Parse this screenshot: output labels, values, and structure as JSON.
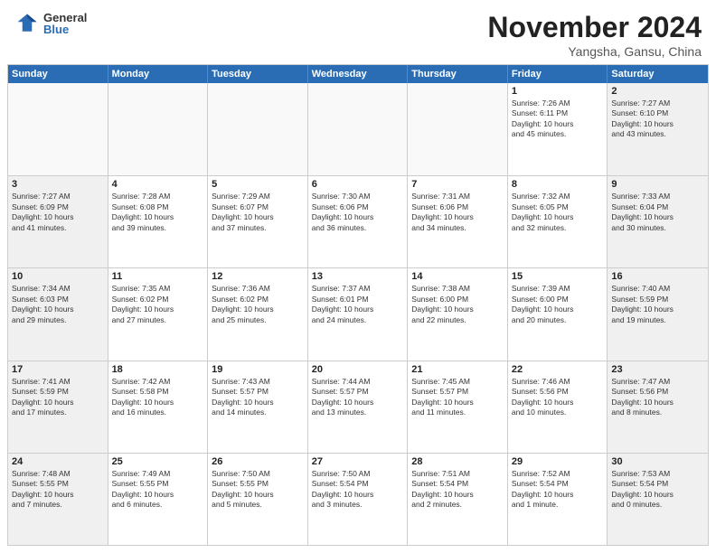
{
  "header": {
    "logo_general": "General",
    "logo_blue": "Blue",
    "title": "November 2024",
    "location": "Yangsha, Gansu, China"
  },
  "weekdays": [
    "Sunday",
    "Monday",
    "Tuesday",
    "Wednesday",
    "Thursday",
    "Friday",
    "Saturday"
  ],
  "weeks": [
    [
      {
        "day": "",
        "info": "",
        "empty": true
      },
      {
        "day": "",
        "info": "",
        "empty": true
      },
      {
        "day": "",
        "info": "",
        "empty": true
      },
      {
        "day": "",
        "info": "",
        "empty": true
      },
      {
        "day": "",
        "info": "",
        "empty": true
      },
      {
        "day": "1",
        "info": "Sunrise: 7:26 AM\nSunset: 6:11 PM\nDaylight: 10 hours\nand 45 minutes.",
        "empty": false
      },
      {
        "day": "2",
        "info": "Sunrise: 7:27 AM\nSunset: 6:10 PM\nDaylight: 10 hours\nand 43 minutes.",
        "empty": false
      }
    ],
    [
      {
        "day": "3",
        "info": "Sunrise: 7:27 AM\nSunset: 6:09 PM\nDaylight: 10 hours\nand 41 minutes.",
        "empty": false
      },
      {
        "day": "4",
        "info": "Sunrise: 7:28 AM\nSunset: 6:08 PM\nDaylight: 10 hours\nand 39 minutes.",
        "empty": false
      },
      {
        "day": "5",
        "info": "Sunrise: 7:29 AM\nSunset: 6:07 PM\nDaylight: 10 hours\nand 37 minutes.",
        "empty": false
      },
      {
        "day": "6",
        "info": "Sunrise: 7:30 AM\nSunset: 6:06 PM\nDaylight: 10 hours\nand 36 minutes.",
        "empty": false
      },
      {
        "day": "7",
        "info": "Sunrise: 7:31 AM\nSunset: 6:06 PM\nDaylight: 10 hours\nand 34 minutes.",
        "empty": false
      },
      {
        "day": "8",
        "info": "Sunrise: 7:32 AM\nSunset: 6:05 PM\nDaylight: 10 hours\nand 32 minutes.",
        "empty": false
      },
      {
        "day": "9",
        "info": "Sunrise: 7:33 AM\nSunset: 6:04 PM\nDaylight: 10 hours\nand 30 minutes.",
        "empty": false
      }
    ],
    [
      {
        "day": "10",
        "info": "Sunrise: 7:34 AM\nSunset: 6:03 PM\nDaylight: 10 hours\nand 29 minutes.",
        "empty": false
      },
      {
        "day": "11",
        "info": "Sunrise: 7:35 AM\nSunset: 6:02 PM\nDaylight: 10 hours\nand 27 minutes.",
        "empty": false
      },
      {
        "day": "12",
        "info": "Sunrise: 7:36 AM\nSunset: 6:02 PM\nDaylight: 10 hours\nand 25 minutes.",
        "empty": false
      },
      {
        "day": "13",
        "info": "Sunrise: 7:37 AM\nSunset: 6:01 PM\nDaylight: 10 hours\nand 24 minutes.",
        "empty": false
      },
      {
        "day": "14",
        "info": "Sunrise: 7:38 AM\nSunset: 6:00 PM\nDaylight: 10 hours\nand 22 minutes.",
        "empty": false
      },
      {
        "day": "15",
        "info": "Sunrise: 7:39 AM\nSunset: 6:00 PM\nDaylight: 10 hours\nand 20 minutes.",
        "empty": false
      },
      {
        "day": "16",
        "info": "Sunrise: 7:40 AM\nSunset: 5:59 PM\nDaylight: 10 hours\nand 19 minutes.",
        "empty": false
      }
    ],
    [
      {
        "day": "17",
        "info": "Sunrise: 7:41 AM\nSunset: 5:59 PM\nDaylight: 10 hours\nand 17 minutes.",
        "empty": false
      },
      {
        "day": "18",
        "info": "Sunrise: 7:42 AM\nSunset: 5:58 PM\nDaylight: 10 hours\nand 16 minutes.",
        "empty": false
      },
      {
        "day": "19",
        "info": "Sunrise: 7:43 AM\nSunset: 5:57 PM\nDaylight: 10 hours\nand 14 minutes.",
        "empty": false
      },
      {
        "day": "20",
        "info": "Sunrise: 7:44 AM\nSunset: 5:57 PM\nDaylight: 10 hours\nand 13 minutes.",
        "empty": false
      },
      {
        "day": "21",
        "info": "Sunrise: 7:45 AM\nSunset: 5:57 PM\nDaylight: 10 hours\nand 11 minutes.",
        "empty": false
      },
      {
        "day": "22",
        "info": "Sunrise: 7:46 AM\nSunset: 5:56 PM\nDaylight: 10 hours\nand 10 minutes.",
        "empty": false
      },
      {
        "day": "23",
        "info": "Sunrise: 7:47 AM\nSunset: 5:56 PM\nDaylight: 10 hours\nand 8 minutes.",
        "empty": false
      }
    ],
    [
      {
        "day": "24",
        "info": "Sunrise: 7:48 AM\nSunset: 5:55 PM\nDaylight: 10 hours\nand 7 minutes.",
        "empty": false
      },
      {
        "day": "25",
        "info": "Sunrise: 7:49 AM\nSunset: 5:55 PM\nDaylight: 10 hours\nand 6 minutes.",
        "empty": false
      },
      {
        "day": "26",
        "info": "Sunrise: 7:50 AM\nSunset: 5:55 PM\nDaylight: 10 hours\nand 5 minutes.",
        "empty": false
      },
      {
        "day": "27",
        "info": "Sunrise: 7:50 AM\nSunset: 5:54 PM\nDaylight: 10 hours\nand 3 minutes.",
        "empty": false
      },
      {
        "day": "28",
        "info": "Sunrise: 7:51 AM\nSunset: 5:54 PM\nDaylight: 10 hours\nand 2 minutes.",
        "empty": false
      },
      {
        "day": "29",
        "info": "Sunrise: 7:52 AM\nSunset: 5:54 PM\nDaylight: 10 hours\nand 1 minute.",
        "empty": false
      },
      {
        "day": "30",
        "info": "Sunrise: 7:53 AM\nSunset: 5:54 PM\nDaylight: 10 hours\nand 0 minutes.",
        "empty": false
      }
    ]
  ]
}
